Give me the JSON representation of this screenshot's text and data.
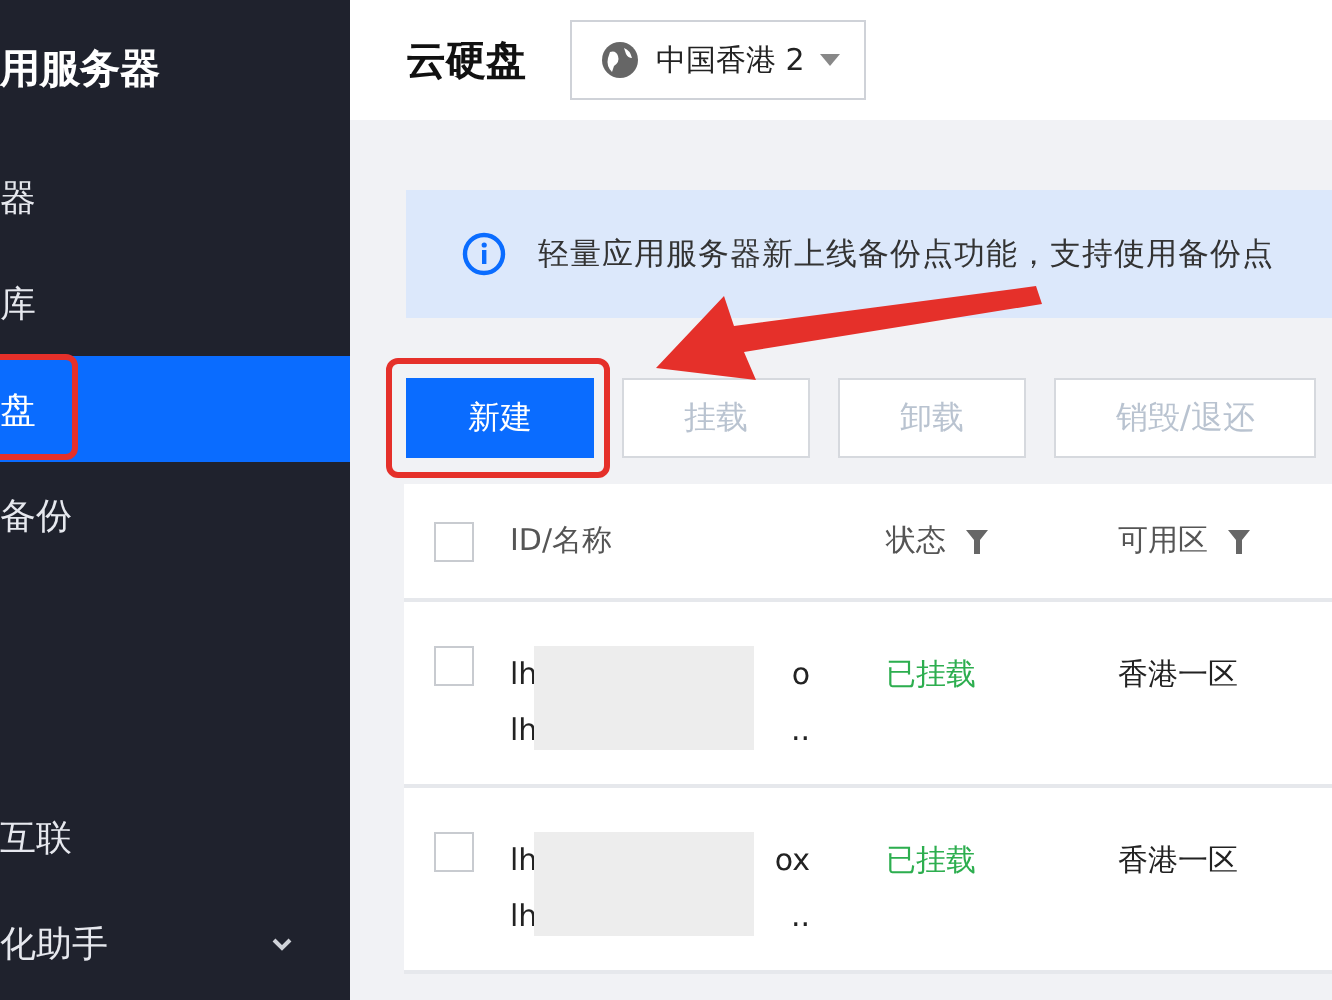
{
  "sidebar": {
    "title": "用服务器",
    "items": [
      {
        "label": "器",
        "selected": false
      },
      {
        "label": "库",
        "selected": false
      },
      {
        "label": "盘",
        "selected": true,
        "highlighted": true
      },
      {
        "label": "备份",
        "selected": false
      },
      {
        "label": "互联",
        "selected": false,
        "gap_before": true
      },
      {
        "label": "化助手",
        "selected": false,
        "expandable": true
      }
    ]
  },
  "header": {
    "title": "云硬盘",
    "region": "中国香港 2"
  },
  "banner": {
    "text": "轻量应用服务器新上线备份点功能，支持使用备份点"
  },
  "toolbar": [
    {
      "label": "新建",
      "kind": "primary",
      "highlighted": true,
      "disabled": false
    },
    {
      "label": "挂载",
      "kind": "default",
      "disabled": true
    },
    {
      "label": "卸载",
      "kind": "default",
      "disabled": true
    },
    {
      "label": "销毁/退还",
      "kind": "default",
      "disabled": true
    }
  ],
  "callout_arrow": true,
  "table": {
    "select_all_checked": false,
    "columns": [
      {
        "label": "ID/名称"
      },
      {
        "label": "状态",
        "filter": true
      },
      {
        "label": "可用区",
        "filter": true
      }
    ],
    "rows": [
      {
        "checked": false,
        "id_lines": [
          {
            "head": "lh",
            "tail": "o"
          },
          {
            "head": "lh",
            "tail": ".."
          }
        ],
        "redacted": true,
        "status": "已挂载",
        "zone": "香港一区"
      },
      {
        "checked": false,
        "id_lines": [
          {
            "head": "lh",
            "tail": "ox"
          },
          {
            "head": "lh",
            "tail": ".."
          }
        ],
        "redacted": true,
        "status": "已挂载",
        "zone": "香港一区"
      }
    ]
  }
}
